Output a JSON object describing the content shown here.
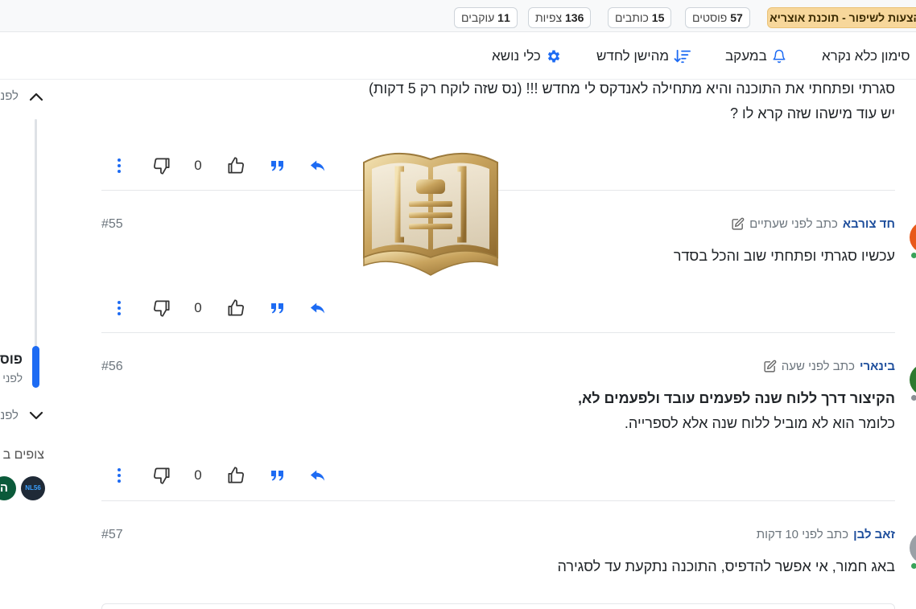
{
  "stats": {
    "title": "הצעות לשיפור - תוכנת אוצריא",
    "posts_count": "57",
    "posts_label": "פוסטים",
    "writers_count": "15",
    "writers_label": "כותבים",
    "views_count": "136",
    "views_label": "צפיות",
    "followers_count": "11",
    "followers_label": "עוקבים"
  },
  "toolbar": {
    "mark_read": "סימון כלא נקרא",
    "tracking": "במעקב",
    "sort": "מהישן לחדש",
    "topic_tools": "כלי נושא"
  },
  "sidebar": {
    "top_label": "לפני",
    "current_title": "פוס",
    "current_sub": "לפני",
    "bottom_label": "לפנ",
    "viewers_label": "צופים ב",
    "avatars": [
      {
        "letter": "ה",
        "color": "#0b5a3a"
      },
      {
        "letter": "NL56",
        "color": "#1f2a37"
      }
    ]
  },
  "posts": [
    {
      "lines": [
        "סגרתי ופתחתי את התוכנה והיא מתחילה לאנדקס לי מחדש !!! (נס שזה לוקח רק 5 דקות)",
        "יש עוד מישהו שזה קרא לו ?"
      ],
      "votes": "0"
    },
    {
      "author": "חד צורבא",
      "meta": "כתב לפני שעתיים",
      "num": "#55",
      "lines": [
        "עכשיו סגרתי ופתחתי שוב והכל בסדר"
      ],
      "votes": "0",
      "avatar_color": "#e8591a",
      "dot_color": "#3aa35a"
    },
    {
      "author": "בינארי",
      "meta": "כתב לפני שעה",
      "num": "#56",
      "bold_line": "הקיצור דרך ללוח שנה לפעמים עובד ולפעמים לא,",
      "lines": [
        "כלומר הוא לא מוביל ללוח שנה אלא לספרייה."
      ],
      "votes": "0",
      "avatar_color": "#2d7a2f",
      "dot_color": "#8a8f94"
    },
    {
      "author": "זאב לבן",
      "meta": "כתב לפני 10 דקות",
      "num": "#57",
      "lines": [
        "באג חמור, אי אפשר להדפיס, התוכנה נתקעת עד לסגירה"
      ],
      "avatar_color": "#9aa0a6",
      "dot_color": "#3aa35a"
    }
  ],
  "colors": {
    "accent": "#1d6bf3",
    "author": "#1e4e9c",
    "title_pill": "#f7d79b"
  }
}
